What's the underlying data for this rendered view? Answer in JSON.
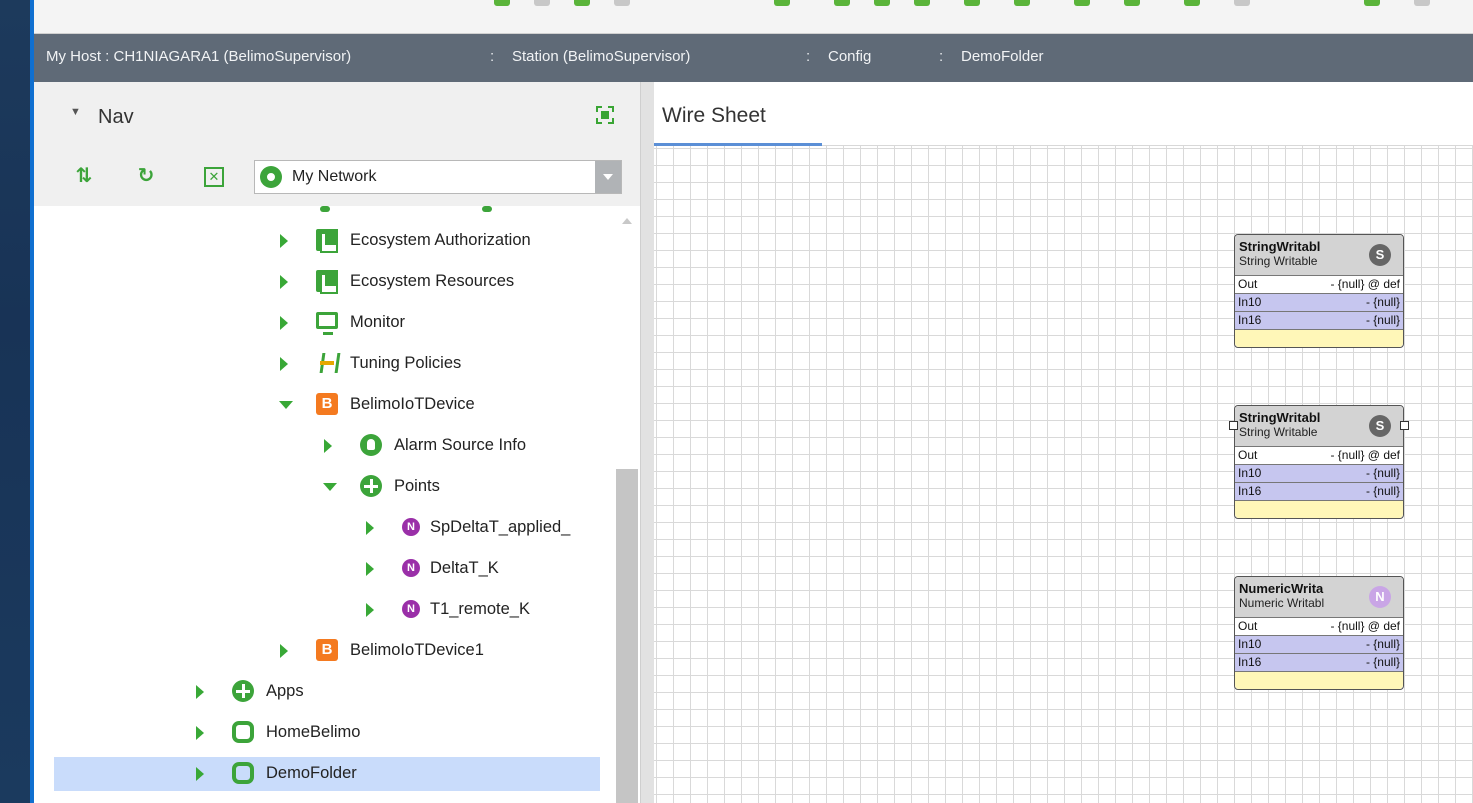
{
  "breadcrumb": {
    "items": [
      "My Host : CH1NIAGARA1 (BelimoSupervisor)",
      "Station (BelimoSupervisor)",
      "Config",
      "DemoFolder"
    ],
    "separator": ":"
  },
  "nav": {
    "title": "Nav",
    "network_select": "My Network",
    "tree": [
      {
        "label": "Ecosystem Authorization",
        "icon": "document-icon"
      },
      {
        "label": "Ecosystem Resources",
        "icon": "document-icon"
      },
      {
        "label": "Monitor",
        "icon": "monitor-icon"
      },
      {
        "label": "Tuning Policies",
        "icon": "tuning-icon"
      },
      {
        "label": "BelimoIoTDevice",
        "icon": "device-b-icon"
      },
      {
        "label": "Alarm Source Info",
        "icon": "alarm-icon"
      },
      {
        "label": "Points",
        "icon": "points-icon"
      },
      {
        "label": "SpDeltaT_applied_",
        "icon": "numeric-point-icon"
      },
      {
        "label": "DeltaT_K",
        "icon": "numeric-point-icon"
      },
      {
        "label": "T1_remote_K",
        "icon": "numeric-point-icon"
      },
      {
        "label": "BelimoIoTDevice1",
        "icon": "device-b-icon"
      },
      {
        "label": "Apps",
        "icon": "apps-icon"
      },
      {
        "label": "HomeBelimo",
        "icon": "folder-icon"
      },
      {
        "label": "DemoFolder",
        "icon": "folder-icon"
      }
    ],
    "badge_b": "B",
    "badge_n": "N"
  },
  "wiresheet": {
    "tab_label": "Wire Sheet",
    "components": [
      {
        "name": "StringWritabl",
        "type": "String Writable",
        "badge": "S",
        "slots": [
          {
            "name": "Out",
            "value": "- {null} @ def"
          },
          {
            "name": "In10",
            "value": "- {null}"
          },
          {
            "name": "In16",
            "value": "- {null}"
          }
        ]
      },
      {
        "name": "StringWritabl",
        "type": "String Writable",
        "badge": "S",
        "slots": [
          {
            "name": "Out",
            "value": "- {null} @ def"
          },
          {
            "name": "In10",
            "value": "- {null}"
          },
          {
            "name": "In16",
            "value": "- {null}"
          }
        ]
      },
      {
        "name": "NumericWrita",
        "type": "Numeric Writabl",
        "badge": "N",
        "slots": [
          {
            "name": "Out",
            "value": "- {null} @ def"
          },
          {
            "name": "In10",
            "value": "- {null}"
          },
          {
            "name": "In16",
            "value": "- {null}"
          }
        ]
      }
    ]
  },
  "colors": {
    "breadcrumb_bg": "#5f6a77",
    "accent_green": "#3ca43a",
    "selection": "#c9dcfb",
    "slot_purple": "#c6c6ef",
    "footer_yellow": "#fff7b8"
  }
}
